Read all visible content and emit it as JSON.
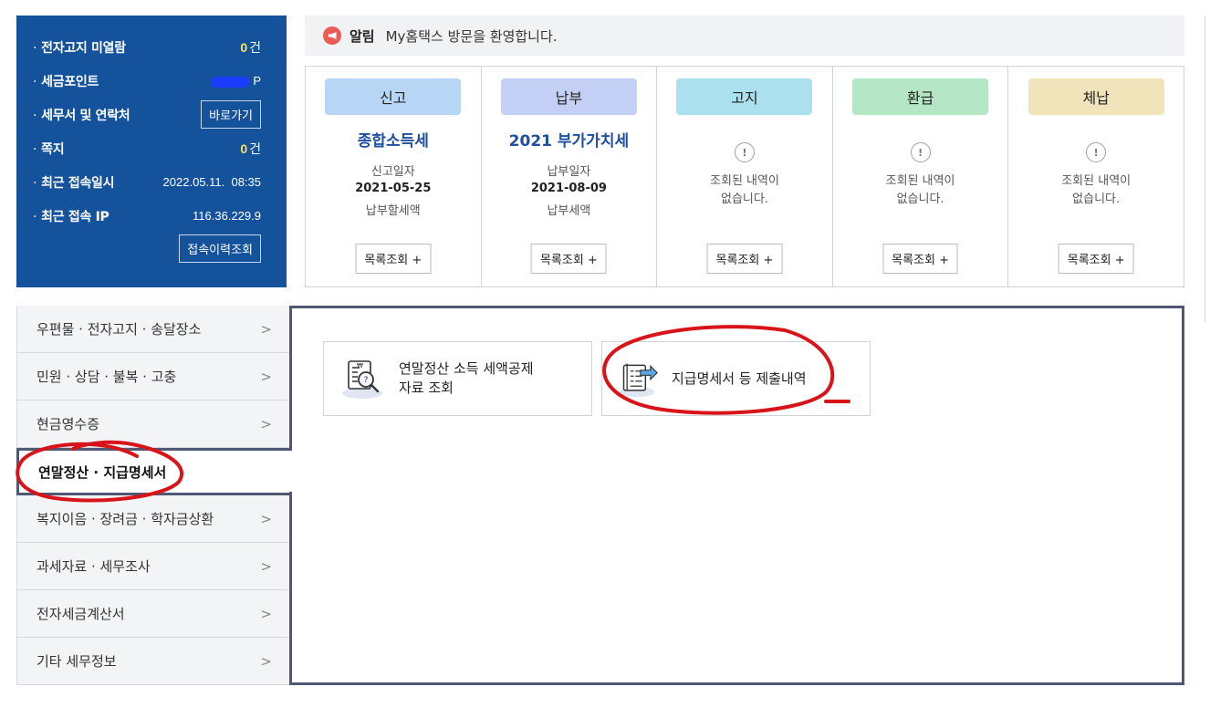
{
  "info": {
    "unread_notice_label": "전자고지 미열람",
    "unread_notice_count": "0",
    "unit_count": "건",
    "tax_point_label": "세금포인트",
    "tax_point_unit": "P",
    "agent_label": "세무서 및 연락처",
    "shortcut_button": "바로가기",
    "memo_label": "쪽지",
    "memo_count": "0",
    "last_login_label": "최근 접속일시",
    "last_login_value": "2022.05.11.  08:35",
    "last_ip_label": "최근 접속 IP",
    "last_ip_value": "116.36.229.9",
    "history_button": "접속이력조회"
  },
  "notice": {
    "tag": "알림",
    "message": "My홈택스 방문을 환영합니다."
  },
  "cards": [
    {
      "head": "신고",
      "color": "#b7d6f6",
      "title": "종합소득세",
      "sub": "신고일자",
      "date": "2021-05-25",
      "sub2": "납부할세액",
      "button": "목록조회 +"
    },
    {
      "head": "납부",
      "color": "#c3cff5",
      "title": "2021 부가가치세",
      "sub": "납부일자",
      "date": "2021-08-09",
      "sub2": "납부세액",
      "button": "목록조회 +"
    },
    {
      "head": "고지",
      "color": "#abe1ee",
      "empty": "조회된 내역이\n없습니다.",
      "button": "목록조회 +"
    },
    {
      "head": "환급",
      "color": "#b5e6c6",
      "empty": "조회된 내역이\n없습니다.",
      "button": "목록조회 +"
    },
    {
      "head": "체납",
      "color": "#f1e4bb",
      "empty": "조회된 내역이\n없습니다.",
      "button": "목록조회 +"
    }
  ],
  "menu": [
    {
      "label": "우편물 · 전자고지 · 송달장소"
    },
    {
      "label": "민원 · 상담 · 불복 · 고충"
    },
    {
      "label": "현금영수증"
    },
    {
      "label": "연말정산 · 지급명세서",
      "active": true
    },
    {
      "label": "복지이음 · 장려금 · 학자금상환"
    },
    {
      "label": "과세자료 · 세무조사"
    },
    {
      "label": "전자세금계산서"
    },
    {
      "label": "기타 세무정보"
    }
  ],
  "tiles": {
    "deduction_line1": "연말정산 소득 세액공제",
    "deduction_line2": "자료 조회",
    "payment_statement": "지급명세서 등 제출내역"
  },
  "colors": {
    "panel_blue": "#14529b",
    "accent_yellow": "#ffe15a",
    "title_blue": "#1e4fa0",
    "frame_navy": "#4e5a74",
    "annotation_red": "#d8141a"
  },
  "icons": [
    "megaphone-icon",
    "exclamation-icon",
    "chevron-right-icon",
    "document-search-icon",
    "document-arrow-icon"
  ]
}
